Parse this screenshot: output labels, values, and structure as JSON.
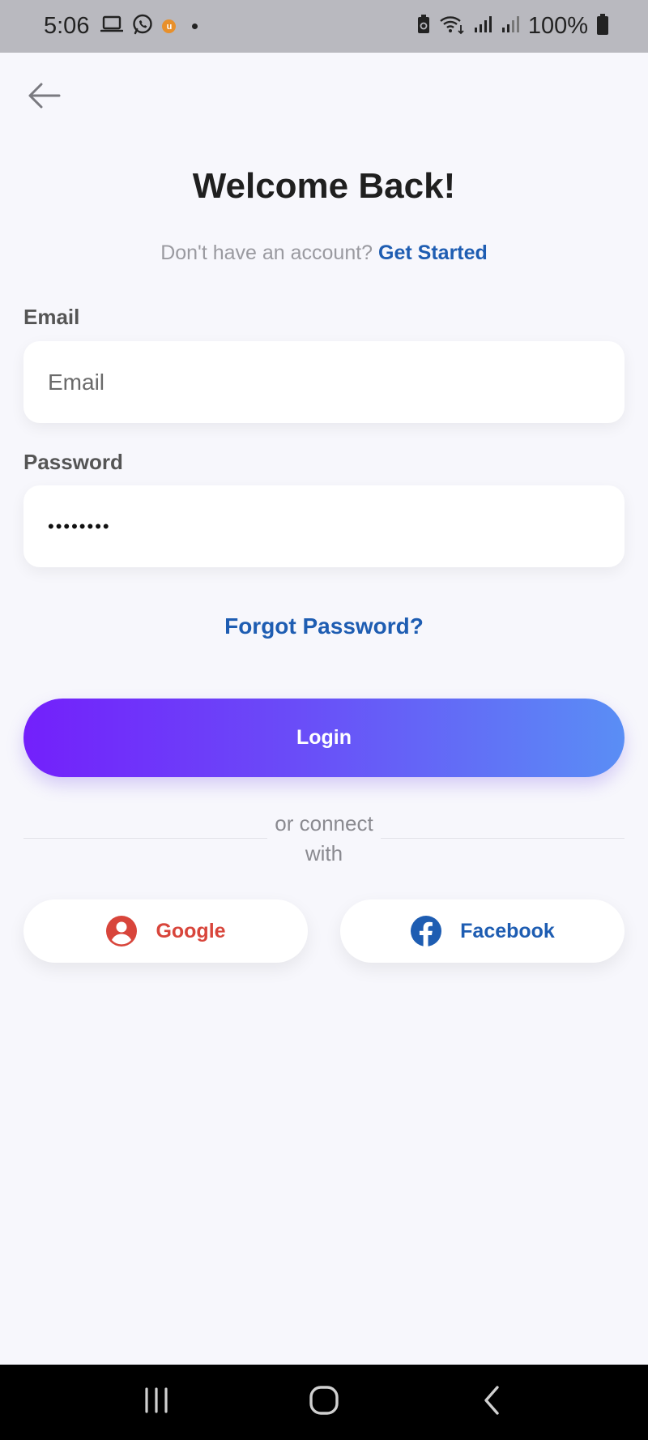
{
  "status_bar": {
    "time": "5:06",
    "battery": "100%",
    "badge": "u"
  },
  "screen": {
    "title": "Welcome Back!",
    "signup_prompt": "Don't have an account?",
    "signup_link": "Get Started",
    "email": {
      "label": "Email",
      "placeholder": "Email",
      "value": ""
    },
    "password": {
      "label": "Password",
      "value": "••••••••"
    },
    "forgot_label": "Forgot Password?",
    "login_label": "Login",
    "divider_text": "or connect with",
    "social": {
      "google_label": "Google",
      "facebook_label": "Facebook"
    }
  },
  "colors": {
    "accent_link": "#1e5db2",
    "google": "#d8453b",
    "facebook": "#1e5db2",
    "gradient_start": "#7320fb",
    "gradient_end": "#5a8ef5",
    "background": "#f7f7fc"
  },
  "icons": {
    "back": "arrow-left-icon",
    "google": "user-circle-icon",
    "facebook": "facebook-icon"
  }
}
